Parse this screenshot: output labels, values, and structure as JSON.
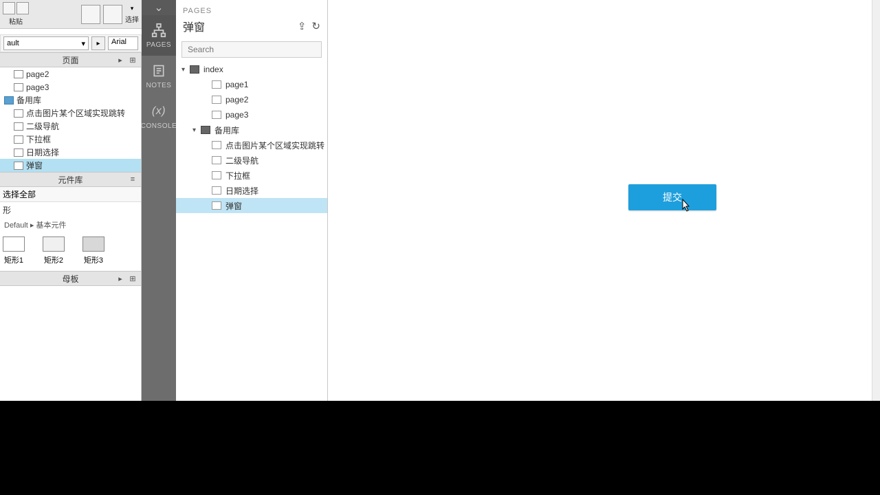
{
  "toolbar": {
    "paste_label": "粘贴",
    "select_label": "选择",
    "style_default": "ault",
    "font_name": "Arial"
  },
  "left": {
    "pages_header": "页面",
    "library_header": "元件库",
    "master_header": "母板",
    "select_all": "选择全部",
    "shape_filter": "形",
    "breadcrumb": "Default ▸ 基本元件",
    "tree": [
      {
        "label": "page2",
        "type": "page"
      },
      {
        "label": "page3",
        "type": "page"
      },
      {
        "label": "备用库",
        "type": "folder"
      },
      {
        "label": "点击图片某个区域实现跳转",
        "type": "page"
      },
      {
        "label": "二级导航",
        "type": "page"
      },
      {
        "label": "下拉框",
        "type": "page"
      },
      {
        "label": "日期选择",
        "type": "page"
      },
      {
        "label": "弹窗",
        "type": "page",
        "selected": true
      }
    ],
    "shapes": [
      {
        "label": "矩形1"
      },
      {
        "label": "矩形2"
      },
      {
        "label": "矩形3"
      }
    ]
  },
  "vtabs": {
    "pages": "PAGES",
    "notes": "NOTES",
    "console": "CONSOLE"
  },
  "pagesPanel": {
    "caption": "PAGES",
    "current": "弹窗",
    "search_placeholder": "Search",
    "tree": [
      {
        "label": "index",
        "type": "folder",
        "indent": 0,
        "caret": true
      },
      {
        "label": "page1",
        "type": "page",
        "indent": 2
      },
      {
        "label": "page2",
        "type": "page",
        "indent": 2
      },
      {
        "label": "page3",
        "type": "page",
        "indent": 2
      },
      {
        "label": "备用库",
        "type": "folder",
        "indent": 1,
        "caret": true
      },
      {
        "label": "点击图片某个区域实现跳转",
        "type": "page",
        "indent": 2
      },
      {
        "label": "二级导航",
        "type": "page",
        "indent": 2
      },
      {
        "label": "下拉框",
        "type": "page",
        "indent": 2
      },
      {
        "label": "日期选择",
        "type": "page",
        "indent": 2
      },
      {
        "label": "弹窗",
        "type": "page",
        "indent": 2,
        "selected": true
      }
    ]
  },
  "canvas": {
    "submit_label": "提交"
  }
}
